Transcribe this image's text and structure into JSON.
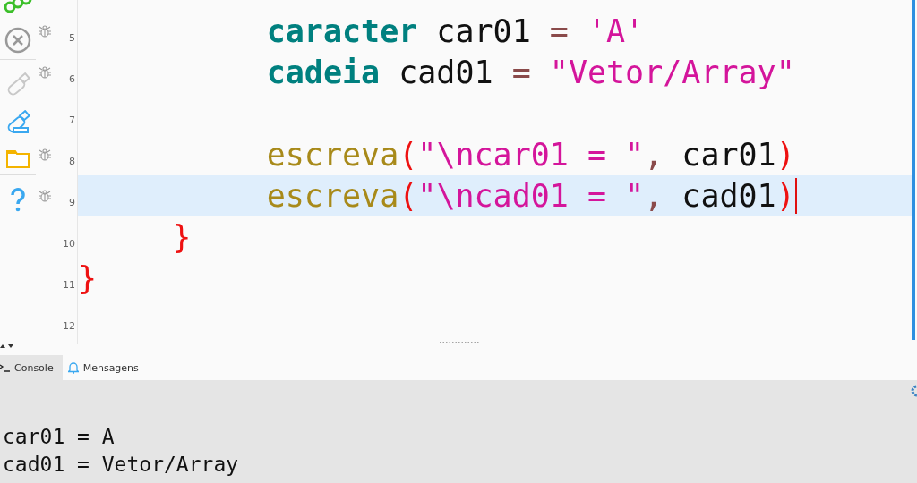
{
  "editor": {
    "lines": [
      {
        "number": "5",
        "debug_marker": true,
        "current": false,
        "kind": "statement",
        "tokens": [
          {
            "kind": "keyword",
            "text": "caracter"
          },
          {
            "kind": "plain",
            "text": " car01 "
          },
          {
            "kind": "operator",
            "text": "="
          },
          {
            "kind": "string",
            "text": " 'A'"
          }
        ]
      },
      {
        "number": "6",
        "debug_marker": true,
        "current": false,
        "kind": "statement",
        "tokens": [
          {
            "kind": "keyword",
            "text": "cadeia"
          },
          {
            "kind": "plain",
            "text": " cad01 "
          },
          {
            "kind": "operator",
            "text": "="
          },
          {
            "kind": "string",
            "text": " \"Vetor/Array\""
          }
        ]
      },
      {
        "number": "7",
        "debug_marker": false,
        "current": false
      },
      {
        "number": "8",
        "debug_marker": true,
        "current": false,
        "kind": "statement",
        "tokens": [
          {
            "kind": "function",
            "text": "escreva"
          },
          {
            "kind": "bracket",
            "text": "("
          },
          {
            "kind": "string",
            "text": "\"\\ncar01 = \""
          },
          {
            "kind": "operator",
            "text": ","
          },
          {
            "kind": "plain",
            "text": " car01"
          },
          {
            "kind": "bracket",
            "text": ")"
          }
        ]
      },
      {
        "number": "9",
        "debug_marker": true,
        "current": true,
        "kind": "statement",
        "tokens": [
          {
            "kind": "function",
            "text": "escreva"
          },
          {
            "kind": "bracket",
            "text": "("
          },
          {
            "kind": "string",
            "text": "\"\\ncad01 = \""
          },
          {
            "kind": "operator",
            "text": ","
          },
          {
            "kind": "plain",
            "text": " cad01"
          },
          {
            "kind": "bracket",
            "text": ")"
          }
        ]
      },
      {
        "number": "10",
        "debug_marker": false,
        "current": false,
        "kind": "block_close",
        "tokens": [
          {
            "kind": "bracket",
            "text": "}"
          }
        ]
      },
      {
        "number": "11",
        "debug_marker": false,
        "current": false,
        "kind": "function_close",
        "tokens": [
          {
            "kind": "bracket",
            "text": "}"
          }
        ]
      },
      {
        "number": "12",
        "debug_marker": false,
        "current": false
      }
    ]
  },
  "bottom_tabs": [
    {
      "label": "Console",
      "selected": true
    },
    {
      "label": "Mensagens",
      "selected": false
    }
  ],
  "console": {
    "lines": [
      "car01 = A",
      "cad01 = Vetor/Array"
    ]
  }
}
